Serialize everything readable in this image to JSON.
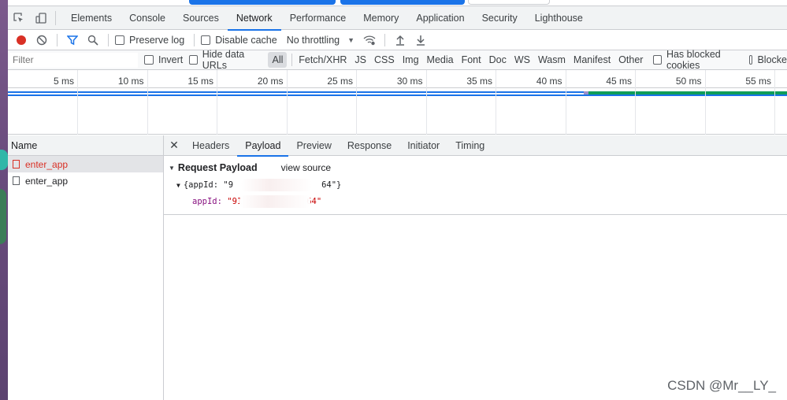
{
  "devtools_tabs": [
    "Elements",
    "Console",
    "Sources",
    "Network",
    "Performance",
    "Memory",
    "Application",
    "Security",
    "Lighthouse"
  ],
  "active_tab": "Network",
  "toolbar": {
    "preserve_log": "Preserve log",
    "disable_cache": "Disable cache",
    "throttling": "No throttling"
  },
  "filter": {
    "placeholder": "Filter",
    "invert": "Invert",
    "hide_data_urls": "Hide data URLs",
    "types": [
      "All",
      "Fetch/XHR",
      "JS",
      "CSS",
      "Img",
      "Media",
      "Font",
      "Doc",
      "WS",
      "Wasm",
      "Manifest",
      "Other"
    ],
    "has_blocked_cookies": "Has blocked cookies",
    "blocked_requests": "Blocke"
  },
  "timeline_ticks": [
    "5 ms",
    "10 ms",
    "15 ms",
    "20 ms",
    "25 ms",
    "30 ms",
    "35 ms",
    "40 ms",
    "45 ms",
    "50 ms",
    "55 ms"
  ],
  "requests": {
    "header": "Name",
    "items": [
      {
        "name": "enter_app",
        "selected": true
      },
      {
        "name": "enter_app",
        "selected": false
      }
    ]
  },
  "detail": {
    "tabs": [
      "Headers",
      "Payload",
      "Preview",
      "Response",
      "Initiator",
      "Timing"
    ],
    "active": "Payload",
    "section_title": "Request Payload",
    "view_source": "view source",
    "object_summary_prefix": "{appId: \"",
    "object_summary_start": "9",
    "object_summary_end": "64\"}",
    "prop_key": "appId",
    "prop_value_start": "\"91",
    "prop_value_end": "64\""
  },
  "watermark": "CSDN @Mr__LY_",
  "colors": {
    "accent": "#1a73e8",
    "record": "#d93025",
    "selected_text": "#d93025"
  }
}
